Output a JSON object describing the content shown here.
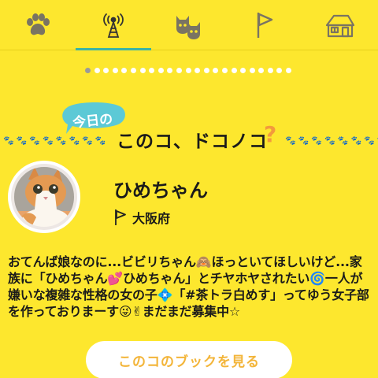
{
  "tabs": [
    {
      "icon": "paw-icon",
      "active": false
    },
    {
      "icon": "broadcast-tower-icon",
      "active": true
    },
    {
      "icon": "cat-faces-icon",
      "active": false
    },
    {
      "icon": "flag-icon",
      "active": false
    },
    {
      "icon": "house-icon",
      "active": false
    }
  ],
  "pager": {
    "count": 23,
    "active_index": 0
  },
  "heading": {
    "bubble_label": "今日の",
    "title": "このコ、ドコノコ",
    "question_mark": "?",
    "paw_trail": "🐾🐾🐾🐾🐾🐾🐾🐾🐾🐾"
  },
  "profile": {
    "name": "ひめちゃん",
    "location": "大阪府",
    "description": "おてんば娘なのに...ビビリちゃん🙈ほっといてほしいけど...家族に「ひめちゃん💕ひめちゃん」とチヤホヤされたい🌀一人が嫌いな複雑な性格の女の子💠「#茶トラ白めす」ってゆう女子部を作っておりまーす😜✌まだまだ募集中☆"
  },
  "button": {
    "label": "このコのブックを見る"
  },
  "colors": {
    "background": "#FDE72E",
    "accent": "#3bb3a4",
    "orange": "#f39a3c",
    "button_text": "#f3b53a"
  }
}
